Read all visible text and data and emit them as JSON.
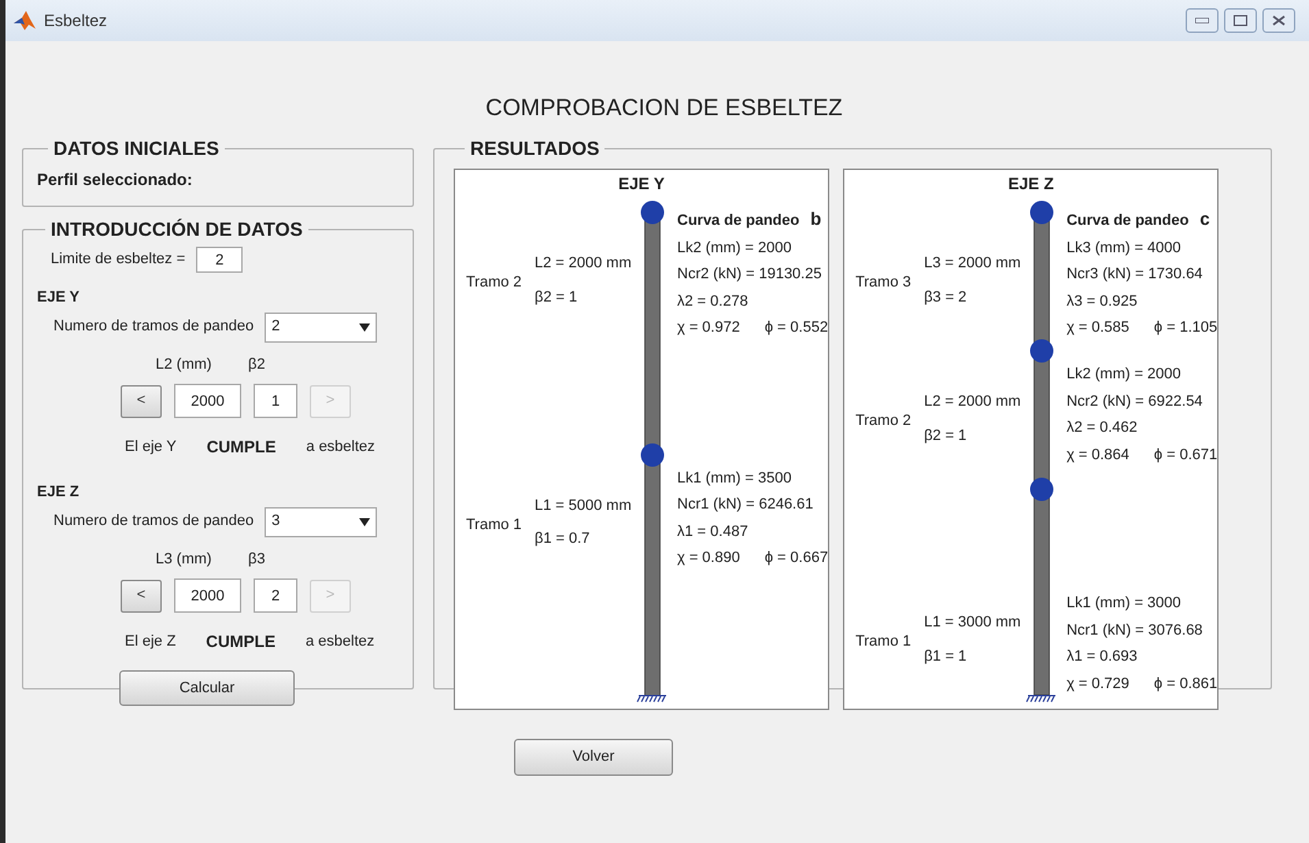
{
  "window": {
    "title": "Esbeltez"
  },
  "heading": "COMPROBACION DE ESBELTEZ",
  "datos_iniciales": {
    "title": "DATOS INICIALES",
    "perfil_label": "Perfil seleccionado:"
  },
  "introduccion": {
    "title": "INTRODUCCIÓN DE DATOS",
    "limite_label": "Limite de esbeltez =",
    "limite_value": "2",
    "ejes": [
      {
        "title": "EJE Y",
        "tramos_label": "Numero de tramos de pandeo",
        "tramos_value": "2",
        "l_label": "L2 (mm)",
        "beta_label": "β2",
        "l_value": "2000",
        "beta_value": "1",
        "prev": {
          "label": "<",
          "disabled": false
        },
        "next": {
          "label": ">",
          "disabled": true
        },
        "status_prefix": "El eje Y",
        "status": "CUMPLE",
        "status_suffix": "a esbeltez"
      },
      {
        "title": "EJE Z",
        "tramos_label": "Numero de tramos de pandeo",
        "tramos_value": "3",
        "l_label": "L3 (mm)",
        "beta_label": "β3",
        "l_value": "2000",
        "beta_value": "2",
        "prev": {
          "label": "<",
          "disabled": false
        },
        "next": {
          "label": ">",
          "disabled": true
        },
        "status_prefix": "El eje Z",
        "status": "CUMPLE",
        "status_suffix": "a esbeltez"
      }
    ],
    "calcular": "Calcular"
  },
  "resultados": {
    "title": "RESULTADOS",
    "panels": [
      {
        "title": "EJE Y",
        "curve_label": "Curva de pandeo",
        "curve_value": "b",
        "tramos": [
          {
            "name": "Tramo 2",
            "length": "L2 = 2000 mm",
            "beta": "β2 =  1",
            "lk": "Lk2 (mm) =  2000",
            "ncr": "Ncr2 (kN) = 19130.25",
            "lambda": "λ2 =  0.278",
            "chi": "χ = 0.972",
            "phi": "ϕ =  0.552"
          },
          {
            "name": "Tramo 1",
            "length": "L1 = 5000 mm",
            "beta": "β1 =  0.7",
            "lk": "Lk1 (mm) =  3500",
            "ncr": "Ncr1 (kN) = 6246.61",
            "lambda": "λ1 =  0.487",
            "chi": "χ = 0.890",
            "phi": "ϕ =  0.667"
          }
        ]
      },
      {
        "title": "EJE Z",
        "curve_label": "Curva de pandeo",
        "curve_value": "c",
        "tramos": [
          {
            "name": "Tramo 3",
            "length": "L3 = 2000 mm",
            "beta": "β3 =  2",
            "lk": "Lk3 (mm) =  4000",
            "ncr": "Ncr3 (kN) = 1730.64",
            "lambda": "λ3 = 0.925",
            "chi": "χ = 0.585",
            "phi": "ϕ =  1.105"
          },
          {
            "name": "Tramo 2",
            "length": "L2 = 2000 mm",
            "beta": "β2 =  1",
            "lk": "Lk2 (mm) =  2000",
            "ncr": "Ncr2 (kN) = 6922.54",
            "lambda": "λ2 = 0.462",
            "chi": "χ = 0.864",
            "phi": "ϕ =  0.671"
          },
          {
            "name": "Tramo 1",
            "length": "L1 = 3000 mm",
            "beta": "β1 =  1",
            "lk": "Lk1 (mm) =  3000",
            "ncr": "Ncr1 (kN) = 3076.68",
            "lambda": "λ1 = 0.693",
            "chi": "χ = 0.729",
            "phi": "ϕ =  0.861"
          }
        ]
      }
    ]
  },
  "volver": "Volver"
}
